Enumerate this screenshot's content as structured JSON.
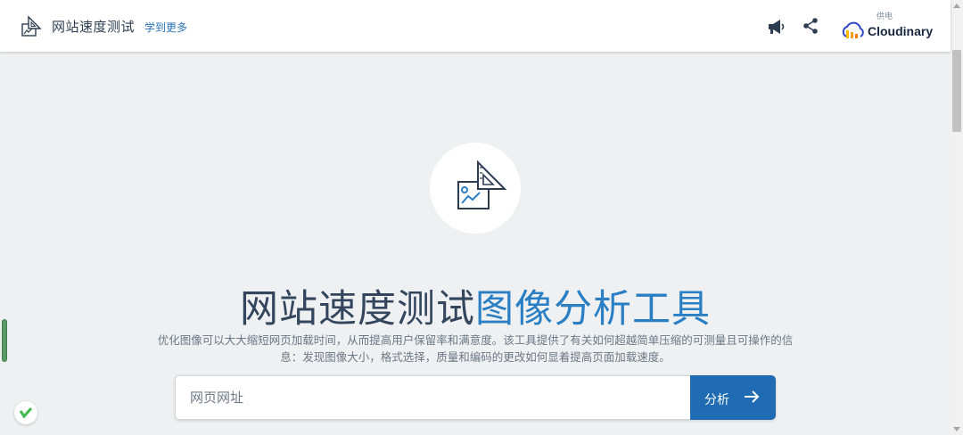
{
  "header": {
    "brand_title": "网站速度测试",
    "learn_more": "学到更多",
    "powered_by": "供电",
    "partner_name": "Cloudinary",
    "icons": [
      "brand-logo-icon",
      "megaphone-icon",
      "share-icon",
      "cloudinary-logo-icon"
    ]
  },
  "hero": {
    "title_part1": "网站速度测试",
    "title_part2": "图像分析工具",
    "description": "优化图像可以大大缩短网页加载时间，从而提高用户保留率和满意度。该工具提供了有关如何超越简单压缩的可测量且可操作的信息：发现图像大小，格式选择，质量和编码的更改如何显着提高页面加载速度。",
    "icon": "image-analysis-icon"
  },
  "form": {
    "url_value": "",
    "url_placeholder": "网页网址",
    "submit_label": "分析",
    "submit_icon": "arrow-right-icon"
  },
  "colors": {
    "background": "#eff0f1",
    "title_dark": "#34465e",
    "accent_blue": "#2a7fc4",
    "button_blue": "#1f6bb4",
    "link_blue": "#2a73b8"
  }
}
